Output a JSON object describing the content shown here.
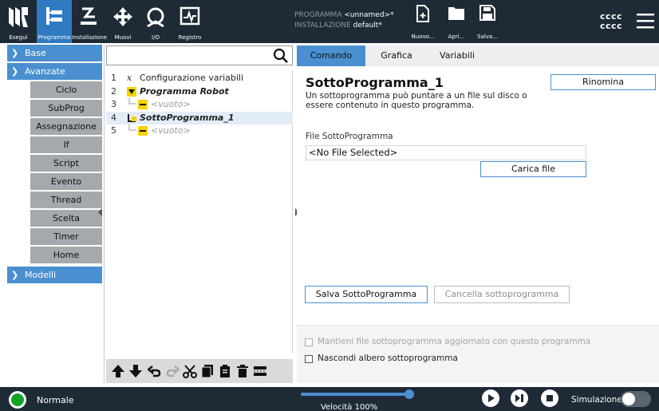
{
  "topbar": {
    "tabs": [
      {
        "label": "Esegui",
        "icon": "ur-logo-icon"
      },
      {
        "label": "Programma",
        "icon": "program-tree-icon"
      },
      {
        "label": "Installazione",
        "icon": "installation-icon"
      },
      {
        "label": "Muovi",
        "icon": "move-cross-icon"
      },
      {
        "label": "I/O",
        "icon": "io-icon"
      },
      {
        "label": "Registro",
        "icon": "log-icon"
      }
    ],
    "file_info": {
      "program_label": "PROGRAMMA",
      "program_value": "<unnamed>*",
      "installation_label": "INSTALLAZIONE",
      "installation_value": "default*"
    },
    "file_buttons": [
      {
        "label": "Nuovo...",
        "icon": "new-file-icon"
      },
      {
        "label": "Apri...",
        "icon": "open-folder-icon"
      },
      {
        "label": "Salva...",
        "icon": "save-icon"
      }
    ],
    "user_lines": [
      "cccc",
      "cccc"
    ]
  },
  "sidebar": {
    "categories": [
      {
        "label": "Base",
        "expanded": false
      },
      {
        "label": "Avanzate",
        "expanded": true
      },
      {
        "label": "Modelli",
        "expanded": false
      }
    ],
    "advanced_items": [
      "Ciclo",
      "SubProg",
      "Assegnazione",
      "If",
      "Script",
      "Evento",
      "Thread",
      "Scelta",
      "Timer",
      "Home"
    ]
  },
  "tree": {
    "search_placeholder": "",
    "rows": [
      {
        "num": "1",
        "text": "Configurazione variabili",
        "style": "normal",
        "indent": 0
      },
      {
        "num": "2",
        "text": "Programma Robot",
        "style": "bold-italic",
        "indent": 0
      },
      {
        "num": "3",
        "text": "<vuoto>",
        "style": "empty",
        "indent": 1
      },
      {
        "num": "4",
        "text": "SottoProgramma_1",
        "style": "bold-italic",
        "indent": 0
      },
      {
        "num": "5",
        "text": "<vuoto>",
        "style": "empty",
        "indent": 1
      }
    ],
    "selected_row": 4
  },
  "tabs": [
    {
      "label": "Comando"
    },
    {
      "label": "Grafica"
    },
    {
      "label": "Variabili"
    }
  ],
  "main": {
    "title": "SottoProgramma_1",
    "rename_label": "Rinomina",
    "description": "Un sottoprogramma può puntare a un file sul disco o essere contenuto in questo programma.",
    "file_label": "File SottoProgramma",
    "file_value": "<No File Selected>",
    "load_label": "Carica file",
    "save_sub_label": "Salva SottoProgramma",
    "delete_sub_label": "Cancella sottoprogramma"
  },
  "options": {
    "keep_updated": "Mantieni file sottoprogramma aggiornato con questo programma",
    "hide_tree": "Nascondi albero sottoprogramma"
  },
  "bottombar": {
    "status": "Normale",
    "speed_label": "Velocità 100%",
    "speed_fraction": 1.0,
    "simulation_label": "Simulazione",
    "simulation_on": false
  },
  "colors": {
    "topbar": "#1f2a37",
    "accent": "#4a90d0",
    "sidebar_item": "#a4a9ae",
    "status_green": "#14a32a"
  }
}
